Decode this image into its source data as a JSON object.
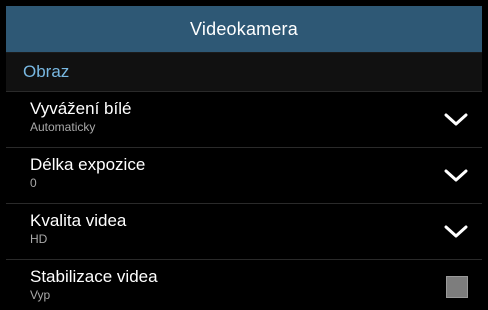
{
  "header": {
    "title": "Videokamera"
  },
  "section": {
    "title": "Obraz"
  },
  "settings": [
    {
      "label": "Vyvážení bílé",
      "value": "Automaticky",
      "control": "dropdown",
      "icon": "chevron-down-icon"
    },
    {
      "label": "Délka expozice",
      "value": "0",
      "control": "dropdown",
      "icon": "chevron-down-icon"
    },
    {
      "label": "Kvalita videa",
      "value": "HD",
      "control": "dropdown",
      "icon": "chevron-down-icon"
    },
    {
      "label": "Stabilizace videa",
      "value": "Vyp",
      "control": "checkbox",
      "checked": false
    }
  ],
  "colors": {
    "header_bg": "#2e5875",
    "section_text": "#78b8e2",
    "background": "#000000",
    "subtext": "#a9a9a9",
    "checkbox": "#7d7d7d"
  }
}
